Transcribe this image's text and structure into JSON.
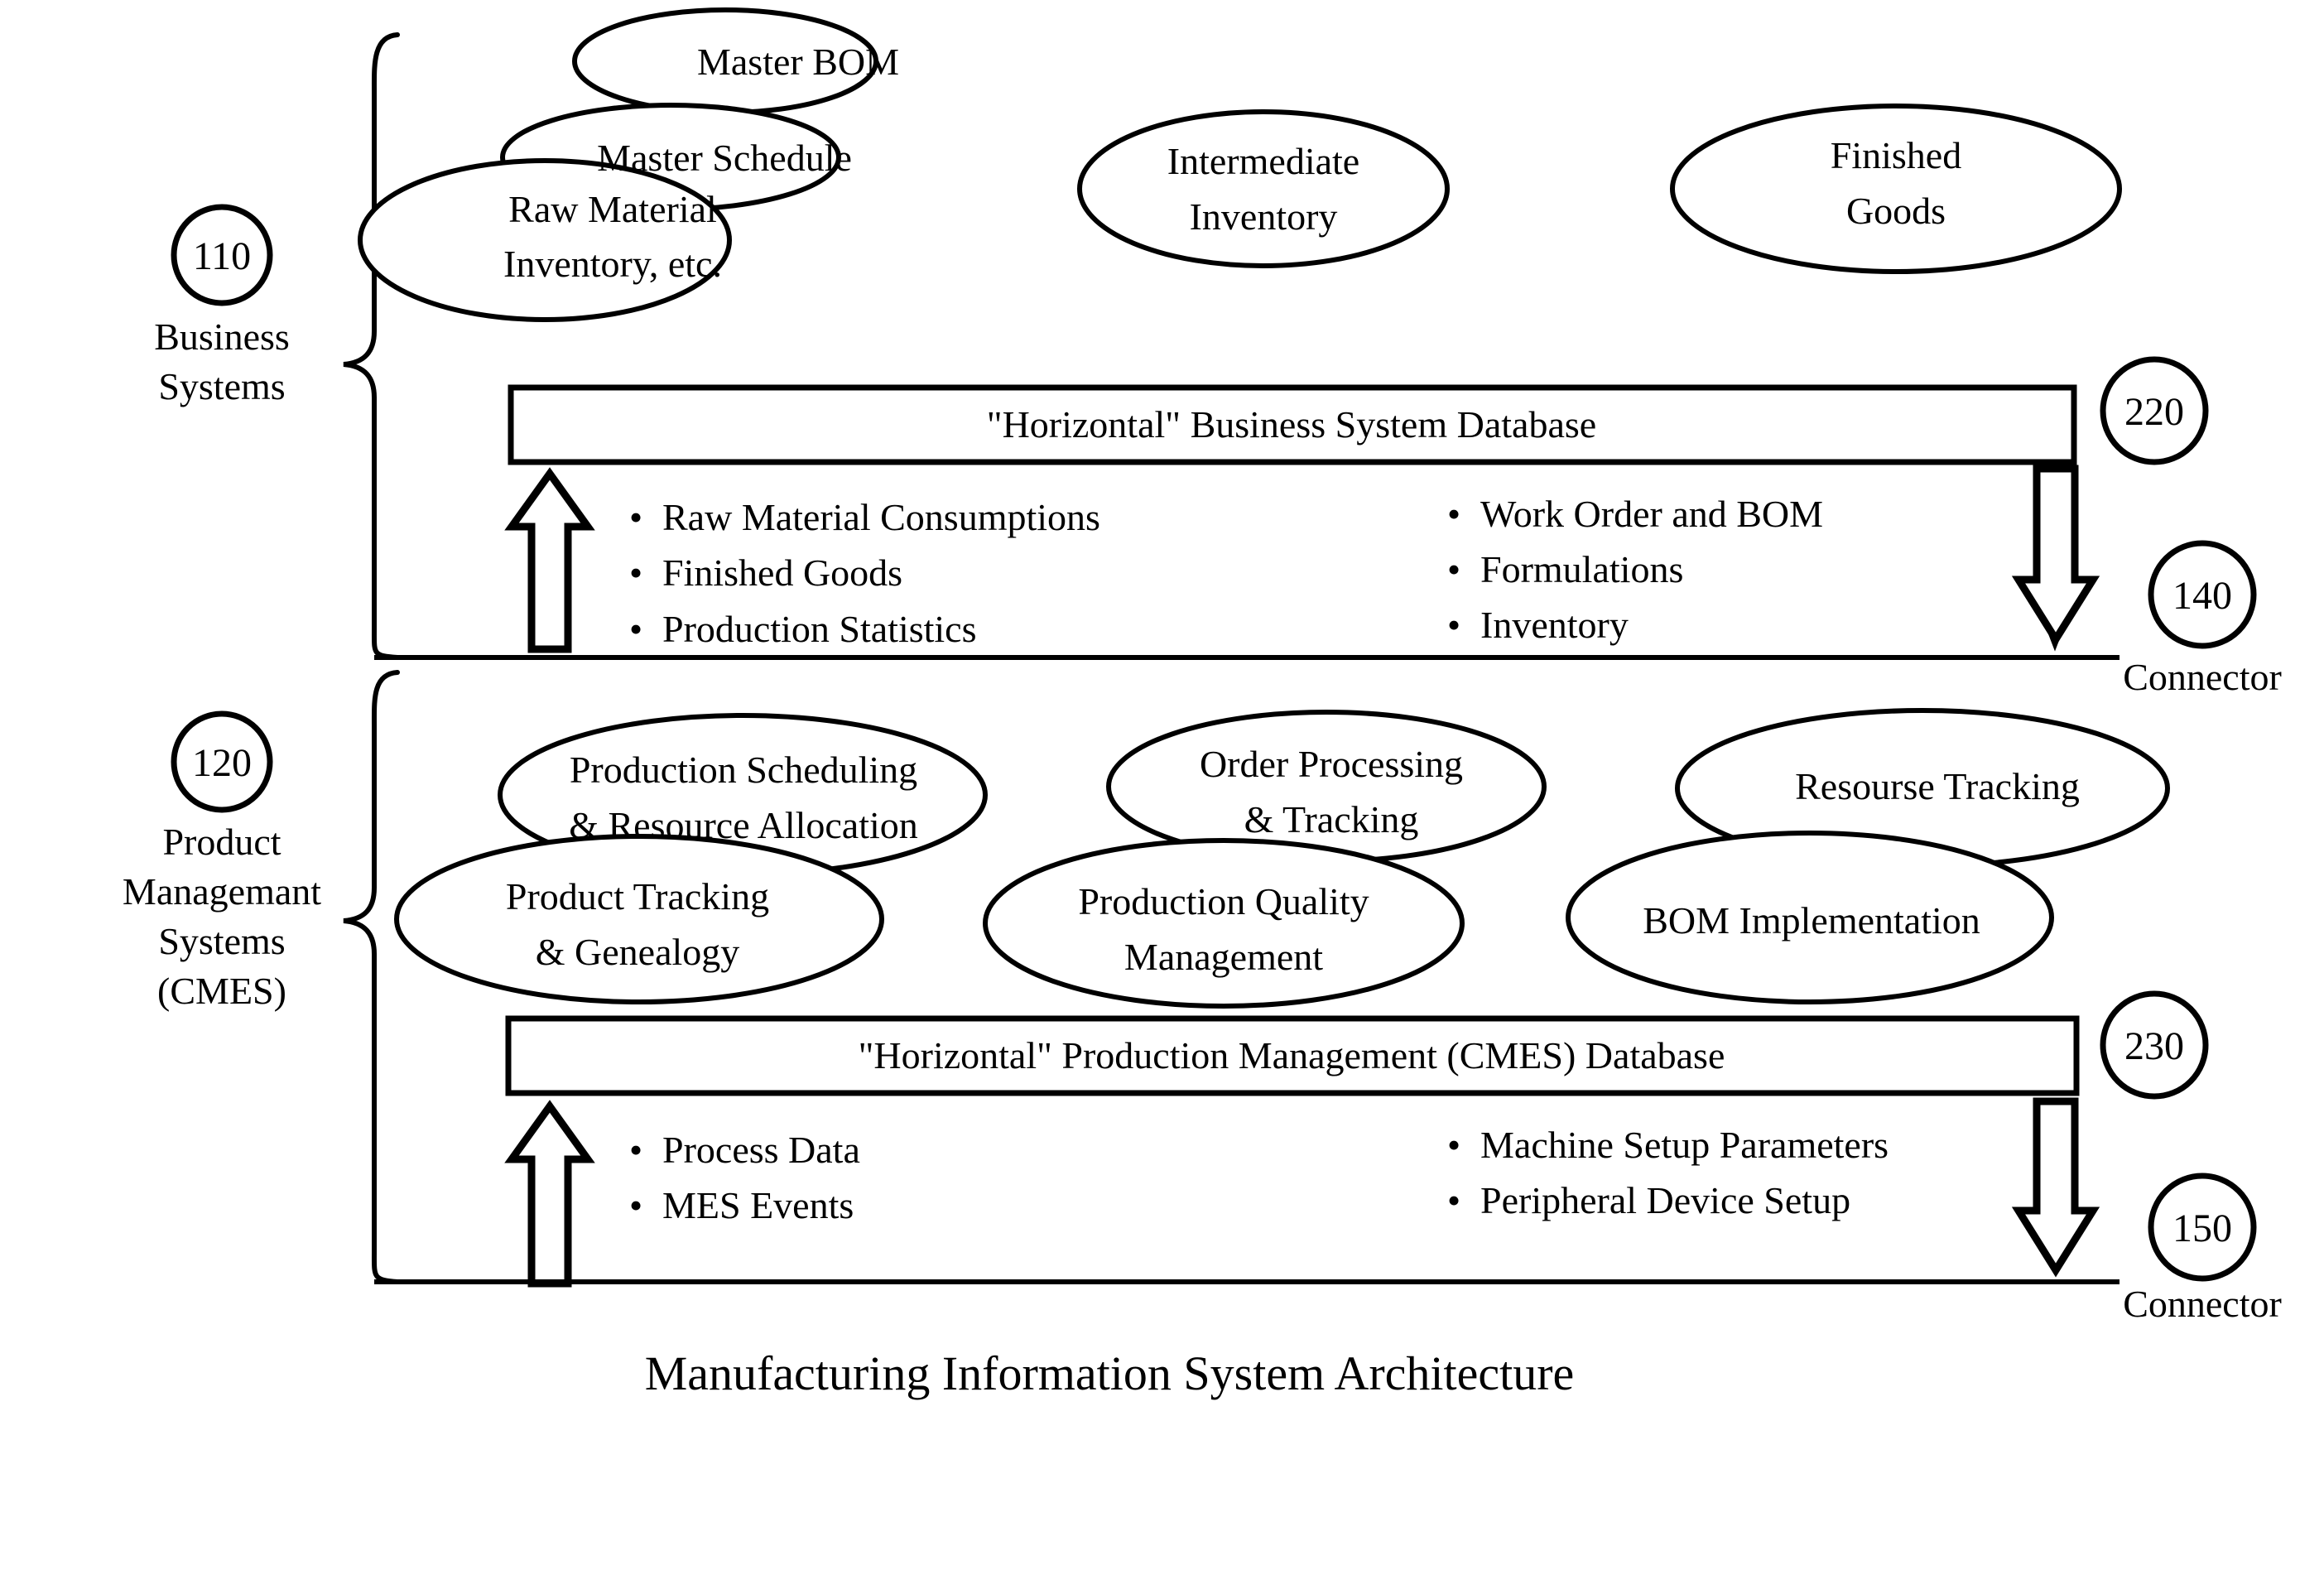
{
  "figure": {
    "title": "Manufacturing Information System Architecture",
    "sections": [
      {
        "ref_number": "110",
        "label_lines": [
          "Business",
          "Systems"
        ],
        "nodes": [
          {
            "name": "master-bom",
            "lines": [
              "Master BOM"
            ]
          },
          {
            "name": "master-schedule",
            "lines": [
              "Master Schedule"
            ]
          },
          {
            "name": "raw-material-inventory",
            "lines": [
              "Raw Material",
              "Inventory, etc."
            ]
          },
          {
            "name": "intermediate-inventory",
            "lines": [
              "Intermediate",
              "Inventory"
            ]
          },
          {
            "name": "finished-goods",
            "lines": [
              "Finished",
              "Goods"
            ]
          }
        ],
        "database_bar": {
          "ref_number": "220",
          "label": "\"Horizontal\" Business System Database"
        },
        "bullets_left": [
          "Raw Material Consumptions",
          "Finished Goods",
          "Production Statistics"
        ],
        "bullets_right": [
          "Work Order and BOM",
          "Formulations",
          "Inventory"
        ],
        "connector": {
          "ref_number": "140",
          "label": "Connector"
        },
        "arrow_up_name": "upload-arrow",
        "arrow_down_name": "download-arrow"
      },
      {
        "ref_number": "120",
        "label_lines": [
          "Product",
          "Managemant",
          "Systems",
          "(CMES)"
        ],
        "nodes": [
          {
            "name": "production-scheduling",
            "lines": [
              "Production Scheduling",
              "& Resource Allocation"
            ]
          },
          {
            "name": "product-tracking",
            "lines": [
              "Product Tracking",
              "& Genealogy"
            ]
          },
          {
            "name": "order-processing",
            "lines": [
              "Order Processing",
              "& Tracking"
            ]
          },
          {
            "name": "production-quality",
            "lines": [
              "Production Quality",
              "Management"
            ]
          },
          {
            "name": "resourse-tracking",
            "lines": [
              "Resourse Tracking"
            ]
          },
          {
            "name": "bom-implementation",
            "lines": [
              "BOM Implementation"
            ]
          }
        ],
        "database_bar": {
          "ref_number": "230",
          "label": "\"Horizontal\" Production Management (CMES) Database"
        },
        "bullets_left": [
          "Process Data",
          "MES Events"
        ],
        "bullets_right": [
          "Machine Setup Parameters",
          "Peripheral Device Setup"
        ],
        "connector": {
          "ref_number": "150",
          "label": "Connector"
        },
        "arrow_up_name": "upload-arrow",
        "arrow_down_name": "download-arrow"
      }
    ],
    "bullet_glyph": "•",
    "colors": {
      "ink": "#000000",
      "paper": "#ffffff"
    }
  }
}
